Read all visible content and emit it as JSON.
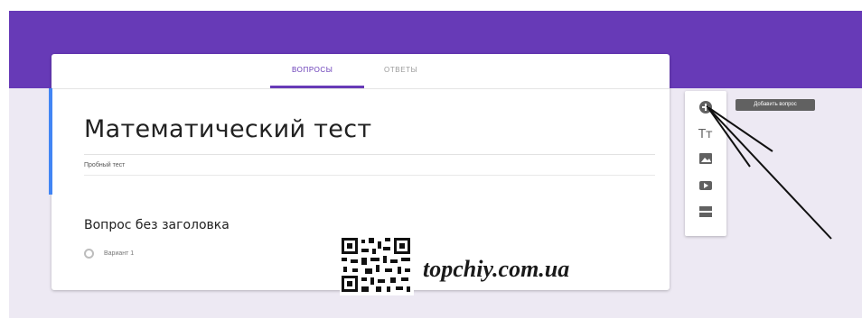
{
  "tabs": [
    {
      "label": "ВОПРОСЫ",
      "active": true
    },
    {
      "label": "ОТВЕТЫ",
      "active": false
    }
  ],
  "form": {
    "title": "Математический тест",
    "description": "Пробный тест"
  },
  "question": {
    "title": "Вопрос без заголовка",
    "option_label": "Вариант 1"
  },
  "toolbar": {
    "tools": [
      "add-circle-icon",
      "text-title-icon",
      "image-icon",
      "video-icon",
      "section-icon"
    ],
    "tooltip": "Добавить вопрос"
  },
  "watermark": {
    "text": "topchiy.com.ua"
  },
  "colors": {
    "header": "#673ab7",
    "page_background": "#ede9f3",
    "active_bar": "#4285f4",
    "tab_active": "#673ab7"
  }
}
